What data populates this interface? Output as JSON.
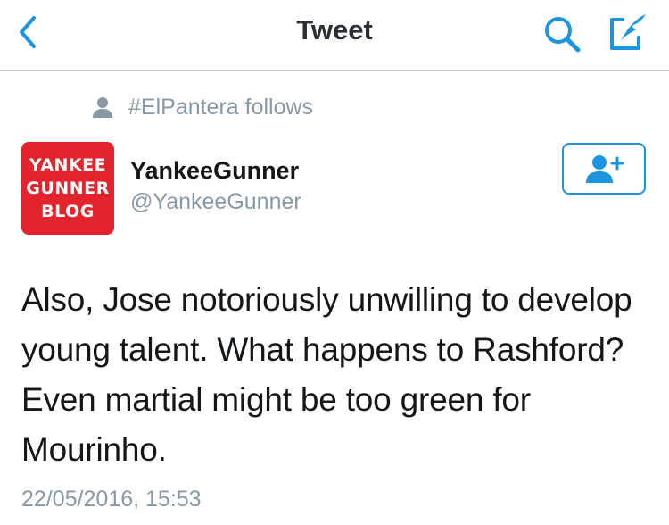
{
  "nav": {
    "title": "Tweet",
    "back_icon": "chevron-left-icon",
    "search_icon": "search-icon",
    "compose_icon": "compose-icon"
  },
  "social_context": {
    "icon": "person-icon",
    "text": "#ElPantera follows"
  },
  "tweet": {
    "avatar_lines": [
      "YANKEE",
      "GUNNER",
      "BLOG"
    ],
    "display_name": "YankeeGunner",
    "handle": "@YankeeGunner",
    "follow_icon": "add-user-icon",
    "text": "Also, Jose notoriously unwilling to develop young talent. What happens to Rashford? Even martial might be too green for Mourinho.",
    "timestamp": "22/05/2016, 15:53"
  },
  "colors": {
    "accent": "#1b95e0",
    "secondary_text": "#8899a6",
    "avatar_bg": "#e4242d"
  }
}
